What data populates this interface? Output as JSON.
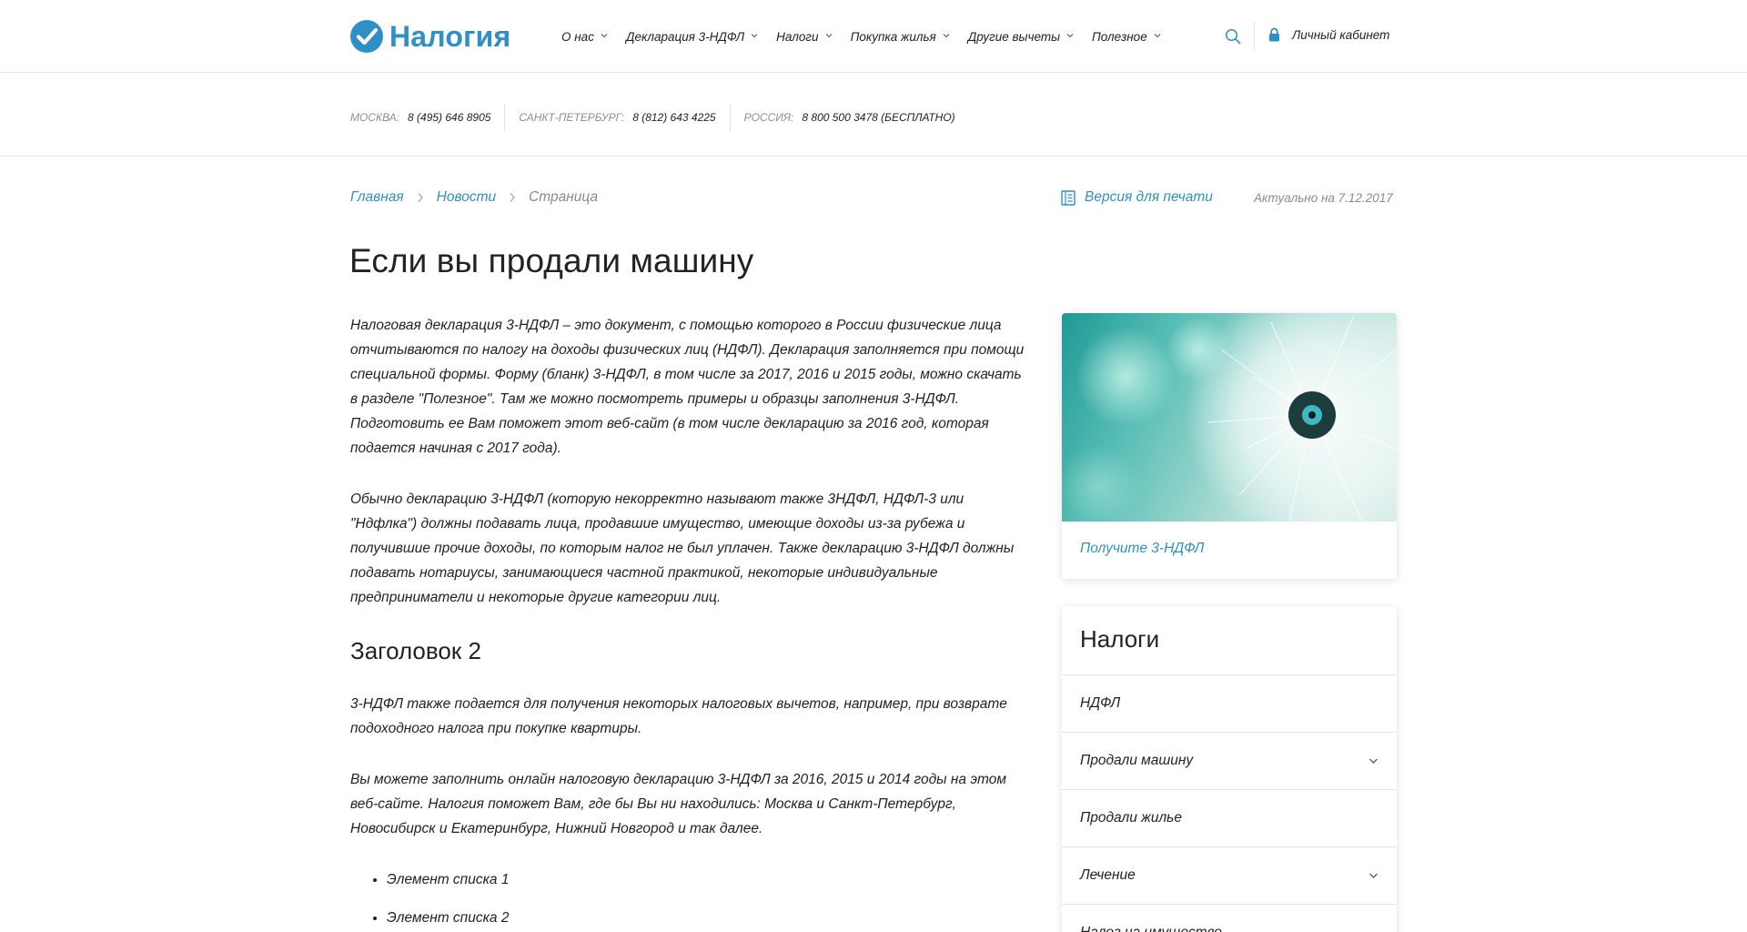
{
  "header": {
    "logo_text": "Налогия",
    "brand_color": "#2f8fc7",
    "nav": [
      {
        "label": "О нас",
        "icon": "chevron-down-icon"
      },
      {
        "label": "Декларация 3-НДФЛ",
        "icon": "chevron-down-icon"
      },
      {
        "label": "Налоги",
        "icon": "chevron-down-icon"
      },
      {
        "label": "Покупка жилья",
        "icon": "chevron-down-icon"
      },
      {
        "label": "Другие вычеты",
        "icon": "chevron-down-icon"
      },
      {
        "label": "Полезное",
        "icon": "chevron-down-icon"
      }
    ],
    "search_icon": "search-icon",
    "cabinet_icon": "lock-icon",
    "cabinet_label": "Личный кабинет"
  },
  "phones": [
    {
      "city": "Москва:",
      "number": "8 (495) 646 8905"
    },
    {
      "city": "Санкт-Петербург:",
      "number": "8 (812) 643 4225"
    },
    {
      "city": "Россия:",
      "number": "8 800 500 3478 (БЕСПЛАТНО)"
    }
  ],
  "breadcrumbs": {
    "items": [
      "Главная",
      "Новости"
    ],
    "current": "Страница"
  },
  "print": {
    "icon": "print-icon",
    "label": "Версия для печати"
  },
  "actual": "Актуально на 7.12.2017",
  "title": "Если вы продали машину",
  "content": {
    "p1": "Налоговая декларация 3-НДФЛ – это документ, с помощью которого в России физические лица отчитываются по налогу на доходы физических лиц (НДФЛ). Декларация заполняется при помощи специальной формы. Форму (бланк) 3-НДФЛ, в том числе за 2017, 2016 и 2015 годы, можно скачать в разделе \"Полезное\". Там же можно посмотреть примеры и образцы заполнения 3-НДФЛ. Подготовить ее Вам поможет этот веб-сайт (в том числе декларацию за 2016 год, которая подается начиная с 2017 года).",
    "p2": "Обычно декларацию 3-НДФЛ (которую некорректно называют также 3НДФЛ, НДФЛ-3 или \"Ндфлка\") должны подавать лица, продавшие имущество, имеющие доходы из-за рубежа и получившие прочие доходы, по которым налог не был уплачен. Также декларацию 3-НДФЛ должны подавать нотариусы, занимающиеся частной практикой, некоторые индивидуальные предприниматели и некоторые другие категории лиц.",
    "h2": "Заголовок 2",
    "p3": "3-НДФЛ также подается для получения некоторых налоговых вычетов, например, при возврате подоходного налога при покупке квартиры.",
    "p4": "Вы можете заполнить онлайн налоговую декларацию 3-НДФЛ за 2016, 2015 и 2014 годы на этом веб-сайте. Налогия поможет Вам, где бы Вы ни находились: Москва и Санкт-Петербург, Новосибирск и Екатеринбург, Нижний Новгород и так далее.",
    "list": [
      "Элемент списка 1",
      "Элемент списка 2"
    ]
  },
  "sidebar": {
    "promo_link": "Получите 3-НДФЛ",
    "menu_title": "Налоги",
    "menu_items": [
      {
        "label": "НДФЛ",
        "has_children": false
      },
      {
        "label": "Продали машину",
        "has_children": true
      },
      {
        "label": "Продали жилье",
        "has_children": false
      },
      {
        "label": "Лечение",
        "has_children": true
      },
      {
        "label": "Налог на имущество",
        "has_children": false
      }
    ]
  }
}
